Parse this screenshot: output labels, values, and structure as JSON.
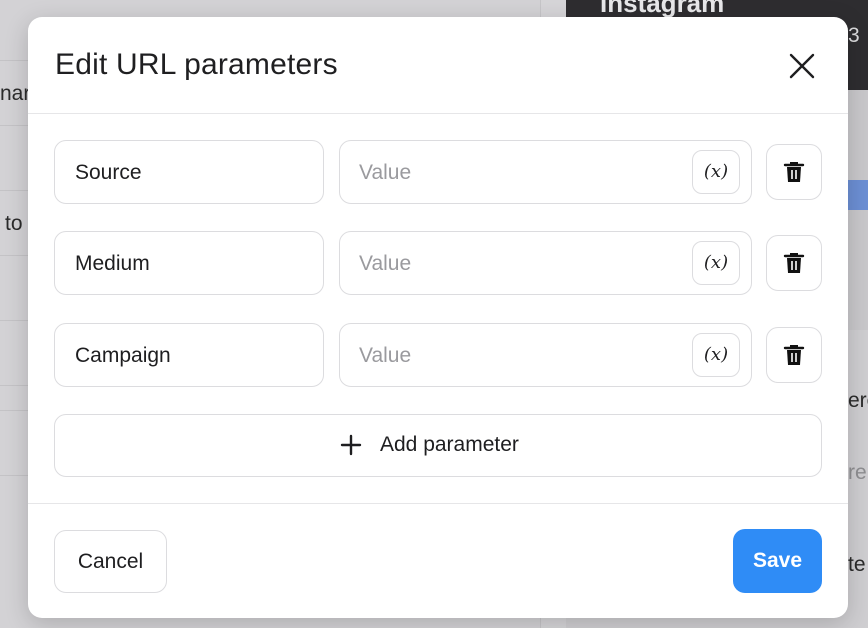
{
  "background": {
    "left_snippets": [
      "nar",
      "to"
    ],
    "preview_title": "Instagram",
    "right_snippets": [
      "3",
      "ere",
      "re",
      "te"
    ]
  },
  "dialog": {
    "title": "Edit URL parameters",
    "close_icon": "close-icon",
    "parameters": [
      {
        "name": "Source",
        "value_placeholder": "Value",
        "var_label": "(x)"
      },
      {
        "name": "Medium",
        "value_placeholder": "Value",
        "var_label": "(x)"
      },
      {
        "name": "Campaign",
        "value_placeholder": "Value",
        "var_label": "(x)"
      }
    ],
    "add_parameter_label": "Add parameter",
    "cancel_label": "Cancel",
    "save_label": "Save"
  },
  "colors": {
    "accent": "#2f8cf6",
    "dialog_bg": "#ffffff",
    "border": "#dcdcdf"
  }
}
